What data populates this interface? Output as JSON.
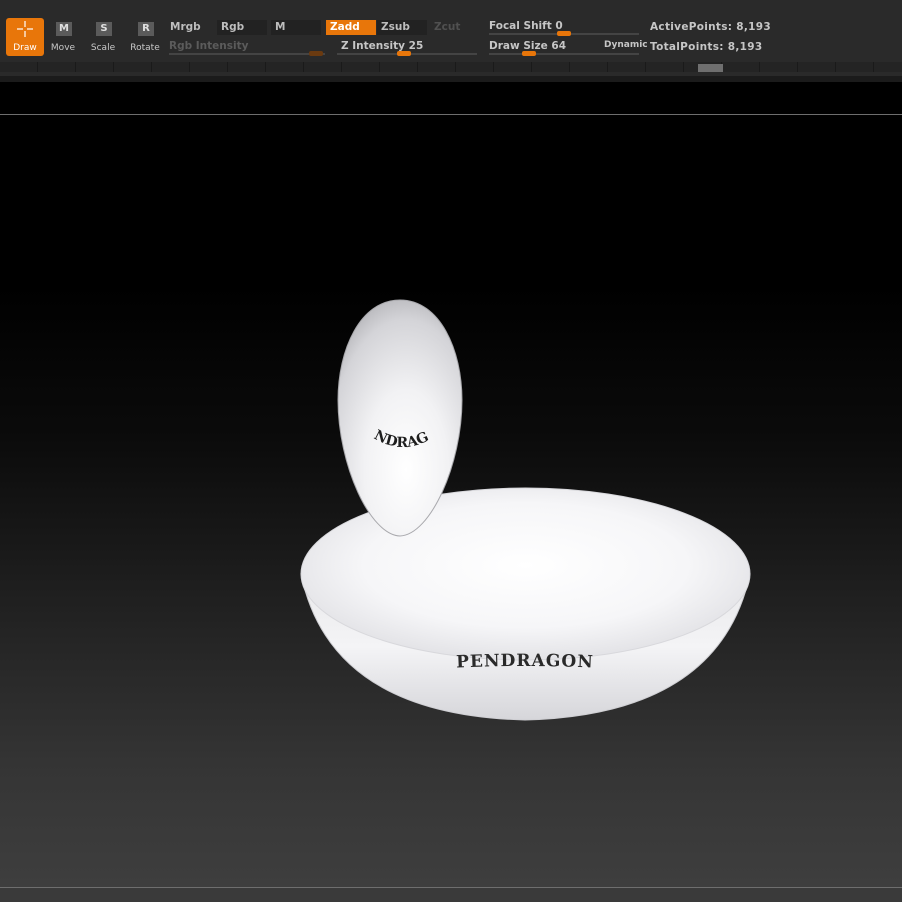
{
  "toolbar": {
    "tools": [
      {
        "label": "Draw",
        "icon": "draw-crosshair-icon",
        "active": true
      },
      {
        "label": "Move",
        "letter": "M",
        "icon": "move-icon"
      },
      {
        "label": "Scale",
        "letter": "S",
        "icon": "scale-icon"
      },
      {
        "label": "Rotate",
        "letter": "R",
        "icon": "rotate-icon"
      }
    ],
    "modes": {
      "mrgb": "Mrgb",
      "rgb": "Rgb",
      "m": "M",
      "zadd": "Zadd",
      "zsub": "Zsub",
      "zcut": "Zcut"
    },
    "sliders": {
      "rgb_intensity": {
        "label": "Rgb Intensity",
        "enabled": false
      },
      "z_intensity": {
        "label": "Z Intensity",
        "value": "25"
      },
      "focal_shift": {
        "label": "Focal Shift",
        "value": "0"
      },
      "draw_size": {
        "label": "Draw Size",
        "value": "64",
        "option": "Dynamic"
      }
    },
    "stats": {
      "active_label": "ActivePoints:",
      "active_value": "8,193",
      "total_label": "TotalPoints:",
      "total_value": "8,193"
    },
    "accent_color": "#e8760a"
  },
  "canvas": {
    "egg_text": "PENDRAGON",
    "bowl_text": "PENDRAGON"
  }
}
